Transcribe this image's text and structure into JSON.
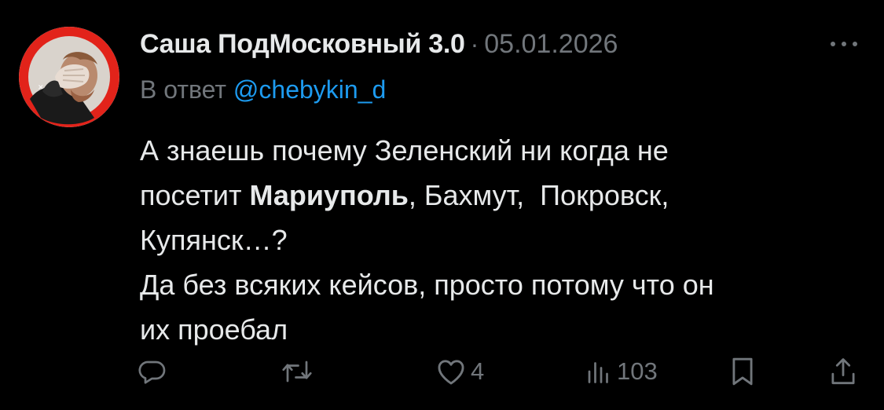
{
  "tweet": {
    "author": {
      "display_name": "Саша ПодМосковный 3.0",
      "avatar": "facepalm-avatar"
    },
    "separator": "·",
    "date": "05.01.2026",
    "reply": {
      "prefix": "В ответ",
      "mention": "@chebykin_d"
    },
    "text": {
      "line1": "А знаешь почему Зеленский ни когда не",
      "line2_before": "посетит ",
      "line2_bold": "Мариуполь",
      "line2_after": ", Бахмут,  Покровск,",
      "line3": "Купянск…?",
      "line4": "Да без всяких кейсов, просто потому что он",
      "line5": "их проебал"
    },
    "actions": {
      "reply": {
        "icon": "reply-icon"
      },
      "repost": {
        "icon": "repost-icon"
      },
      "like": {
        "icon": "heart-icon",
        "count": "4"
      },
      "views": {
        "icon": "views-icon",
        "count": "103"
      },
      "bookmark": {
        "icon": "bookmark-icon"
      },
      "share": {
        "icon": "share-icon"
      }
    },
    "more": {
      "icon": "more-icon"
    }
  },
  "colors": {
    "background": "#000000",
    "primary_text": "#e7e9ea",
    "secondary_text": "#71767b",
    "link": "#1d9bf0",
    "avatar_ring": "#e2231a"
  }
}
